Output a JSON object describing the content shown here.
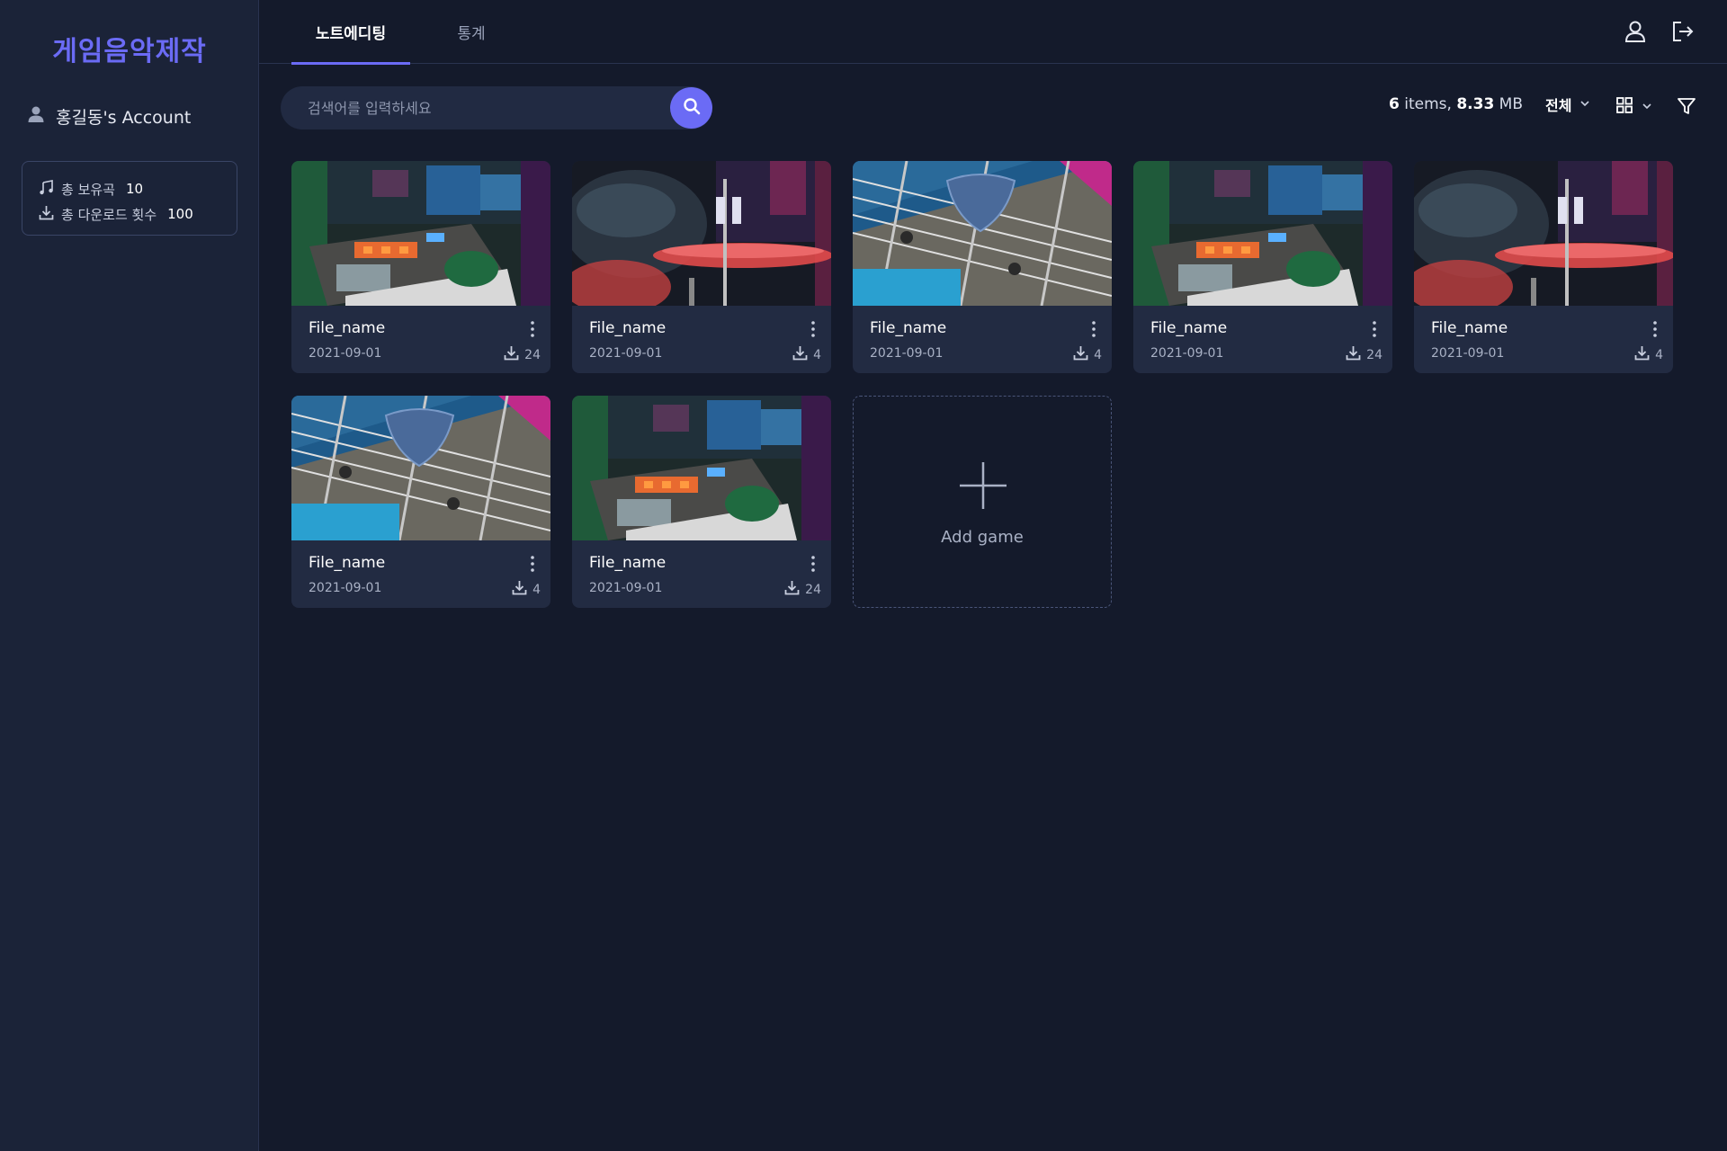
{
  "app": {
    "brand": "게임음악제작"
  },
  "sidebar": {
    "account": "홍길동's Account",
    "stats": [
      {
        "icon": "music-note-icon",
        "label": "총 보유곡",
        "value": "10"
      },
      {
        "icon": "download-icon",
        "label": "총 다운로드 횟수",
        "value": "100"
      }
    ]
  },
  "header": {
    "tabs": [
      {
        "label": "노트에디팅",
        "active": true
      },
      {
        "label": "통계",
        "active": false
      }
    ],
    "icons": [
      "user-icon",
      "logout-icon"
    ]
  },
  "toolbar": {
    "search_placeholder": "검색어를 입력하세요",
    "summary": {
      "count": "6",
      "count_unit": " items, ",
      "size": "8.33",
      "size_unit": " MB"
    },
    "filter_select": "전체",
    "view_mode": "grid-view-icon",
    "filter_icon": "funnel-icon"
  },
  "cards": [
    {
      "title": "File_name",
      "date": "2021-09-01",
      "downloads": "24",
      "image": "keyboard"
    },
    {
      "title": "File_name",
      "date": "2021-09-01",
      "downloads": "4",
      "image": "drums"
    },
    {
      "title": "File_name",
      "date": "2021-09-01",
      "downloads": "4",
      "image": "guitar"
    },
    {
      "title": "File_name",
      "date": "2021-09-01",
      "downloads": "24",
      "image": "keyboard"
    },
    {
      "title": "File_name",
      "date": "2021-09-01",
      "downloads": "4",
      "image": "drums"
    },
    {
      "title": "File_name",
      "date": "2021-09-01",
      "downloads": "4",
      "image": "guitar"
    },
    {
      "title": "File_name",
      "date": "2021-09-01",
      "downloads": "24",
      "image": "keyboard"
    }
  ],
  "add_card": {
    "label": "Add game"
  },
  "colors": {
    "accent": "#6b6bf5",
    "background": "#141a2b",
    "sidebar": "#1b2338",
    "card": "#222b42"
  }
}
